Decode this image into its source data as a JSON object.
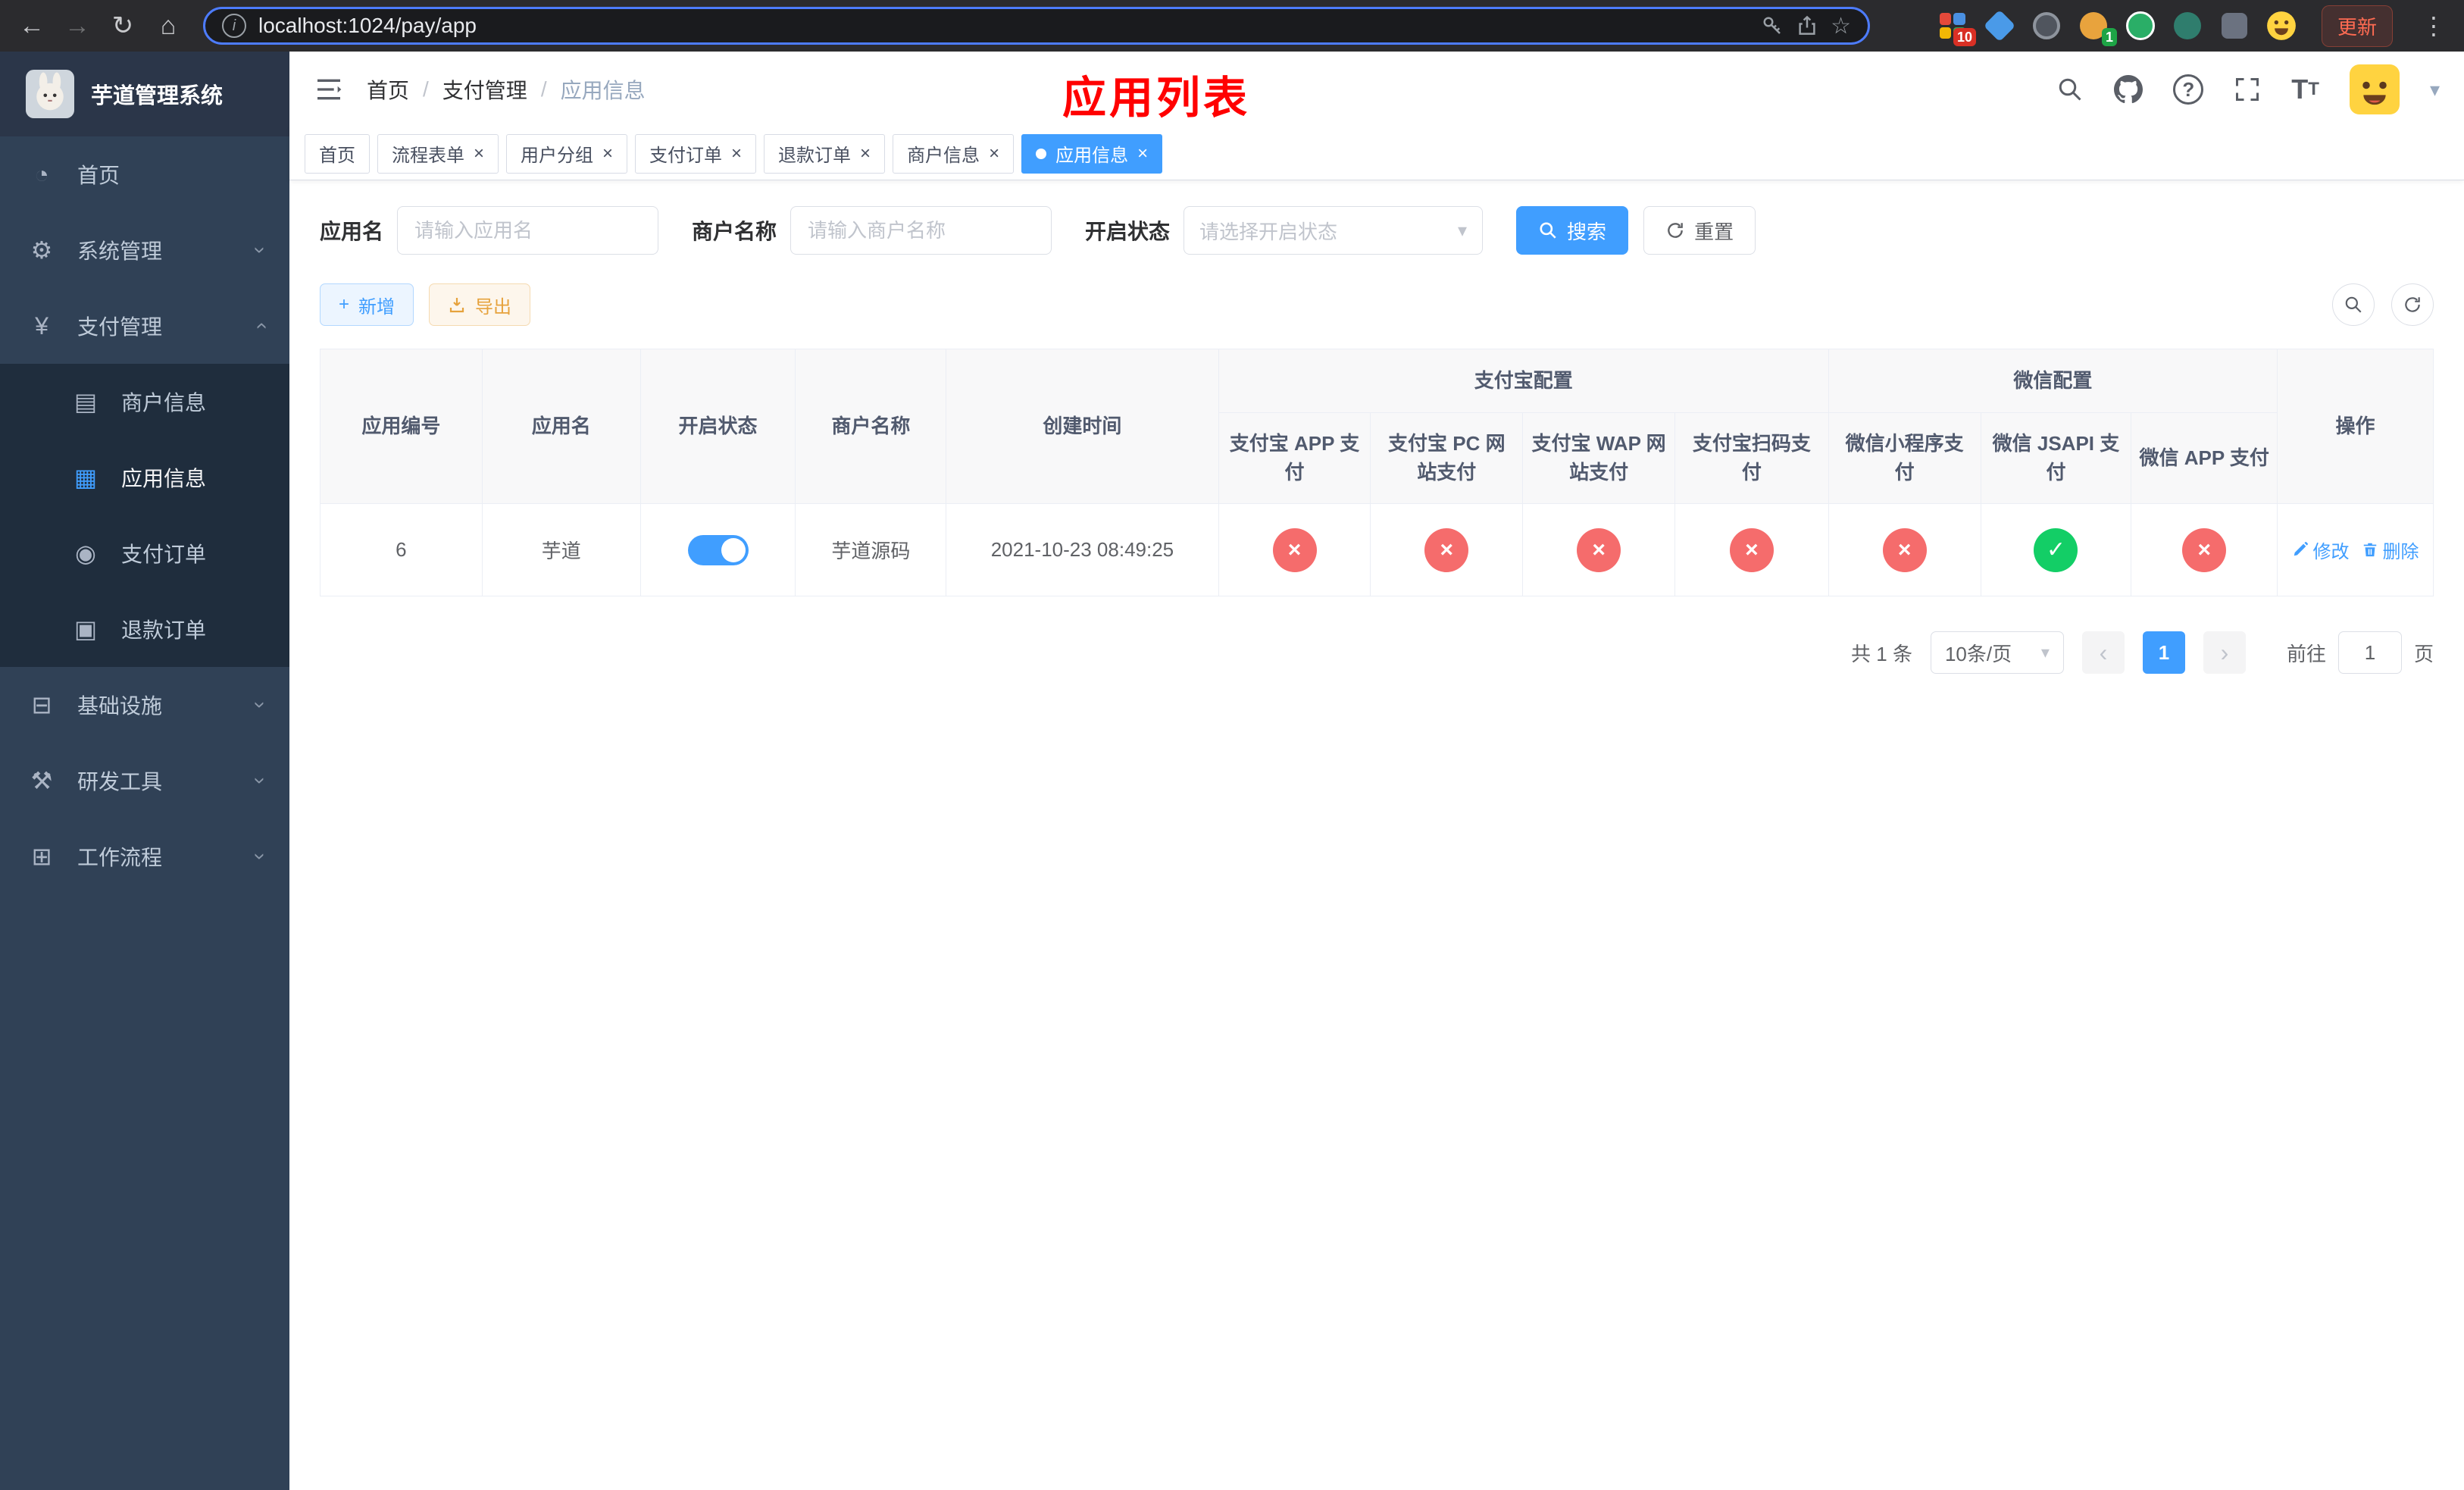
{
  "colors": {
    "accent": "#409EFF",
    "success": "#13ce66",
    "danger": "#f56c6c",
    "warning": "#e6a23c",
    "sidebar_bg": "#304156",
    "submenu_bg": "#1f2d3d",
    "annotation_red": "#ff0000"
  },
  "browser": {
    "url": "localhost:1024/pay/app",
    "update_label": "更新",
    "ext_badge_10": "10",
    "ext_badge_1": "1"
  },
  "sidebar": {
    "title": "芋道管理系统",
    "home": "首页",
    "system": "系统管理",
    "payment": "支付管理",
    "merchant_info": "商户信息",
    "app_info": "应用信息",
    "pay_order": "支付订单",
    "refund_order": "退款订单",
    "infra": "基础设施",
    "dev_tools": "研发工具",
    "workflow": "工作流程"
  },
  "header": {
    "breadcrumb": {
      "home": "首页",
      "section": "支付管理",
      "page": "应用信息"
    },
    "annotation": "应用列表"
  },
  "tabs": [
    {
      "label": "首页"
    },
    {
      "label": "流程表单"
    },
    {
      "label": "用户分组"
    },
    {
      "label": "支付订单"
    },
    {
      "label": "退款订单"
    },
    {
      "label": "商户信息"
    },
    {
      "label": "应用信息"
    }
  ],
  "filters": {
    "app_name_label": "应用名",
    "app_name_placeholder": "请输入应用名",
    "merchant_label": "商户名称",
    "merchant_placeholder": "请输入商户名称",
    "status_label": "开启状态",
    "status_placeholder": "请选择开启状态",
    "search_label": "搜索",
    "reset_label": "重置"
  },
  "toolbar": {
    "add_label": "新增",
    "export_label": "导出"
  },
  "table": {
    "headers": {
      "app_id": "应用编号",
      "app_name": "应用名",
      "status": "开启状态",
      "merchant": "商户名称",
      "created": "创建时间",
      "alipay_group": "支付宝配置",
      "wechat_group": "微信配置",
      "actions": "操作",
      "alipay_app": "支付宝 APP 支付",
      "alipay_pc": "支付宝 PC 网站付",
      "alipay_pc_full": "支付宝 PC 网站支付",
      "alipay_wap": "支付宝 WAP 网站支付",
      "alipay_qr": "支付宝扫码支付",
      "wx_mini": "微信小程序支付",
      "wx_jsapi": "微信 JSAPI 支付",
      "wx_app": "微信 APP 支付"
    },
    "rows": [
      {
        "app_id": "6",
        "app_name": "芋道",
        "status_on": true,
        "merchant": "芋道源码",
        "created": "2021-10-23 08:49:25",
        "configs": [
          "no",
          "no",
          "no",
          "no",
          "no",
          "yes",
          "no"
        ],
        "edit_label": "修改",
        "delete_label": "删除"
      }
    ]
  },
  "pagination": {
    "total": "共 1 条",
    "page_size": "10条/页",
    "page": "1",
    "goto_label": "前往",
    "goto_value": "1",
    "goto_suffix": "页"
  }
}
